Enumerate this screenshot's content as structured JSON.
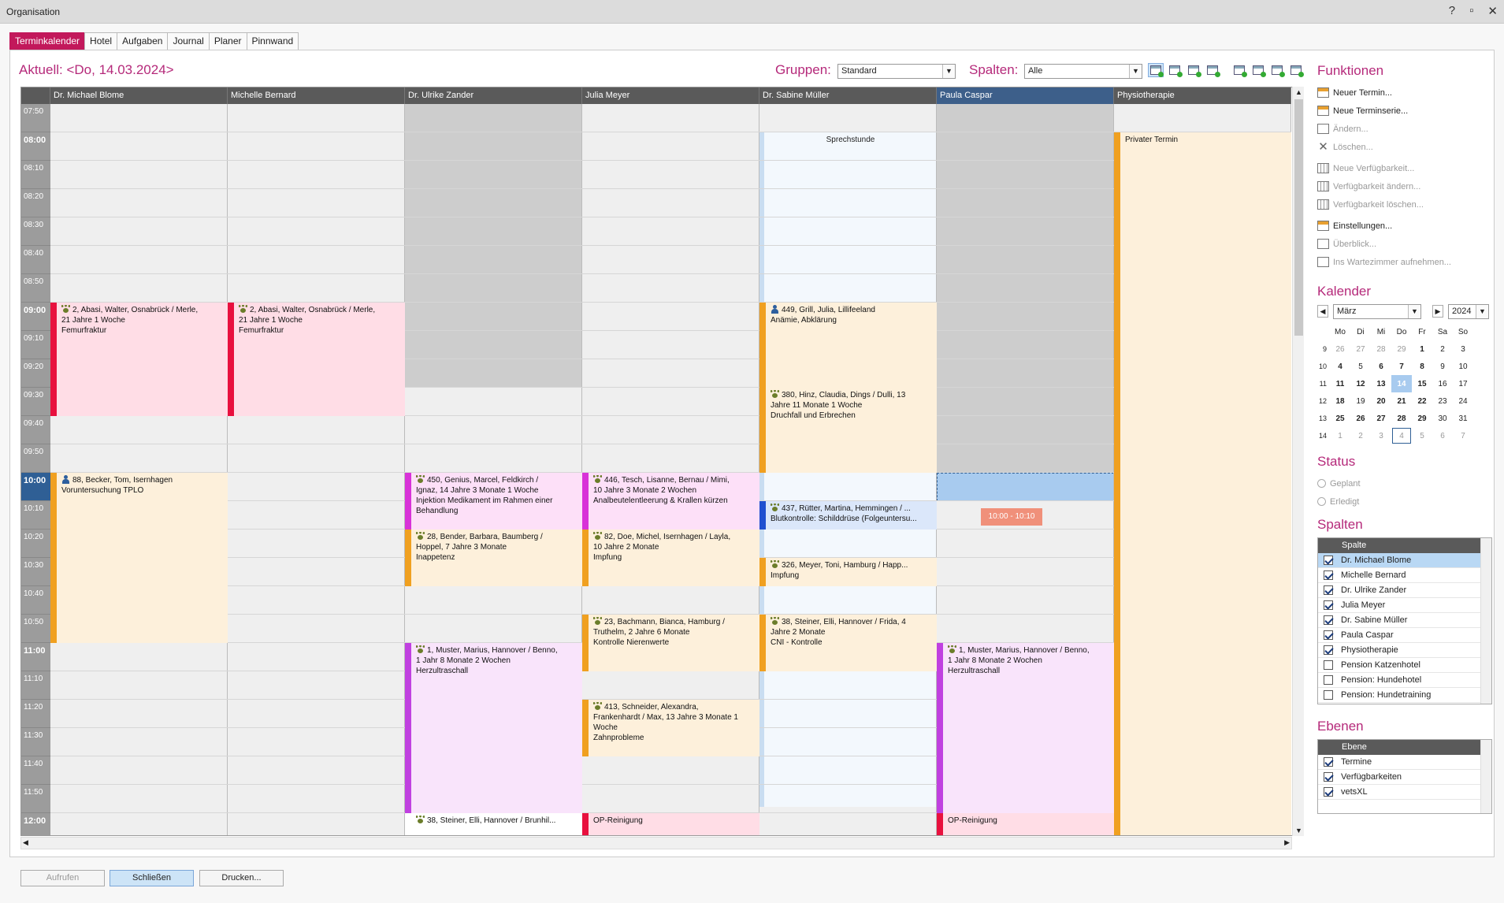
{
  "window": {
    "title": "Organisation",
    "help": "?",
    "minimize": "▫",
    "close": "✕"
  },
  "tabs": [
    "Terminkalender",
    "Hotel",
    "Aufgaben",
    "Journal",
    "Planer",
    "Pinnwand"
  ],
  "header": {
    "aktuell": "Aktuell: <Do, 14.03.2024>",
    "gruppen_label": "Gruppen:",
    "gruppen_value": "Standard",
    "spalten_label": "Spalten:",
    "spalten_value": "Alle"
  },
  "columns": [
    "Dr. Michael Blome",
    "Michelle Bernard",
    "Dr. Ulrike Zander",
    "Julia Meyer",
    "Dr. Sabine Müller",
    "Paula Caspar",
    "Physiotherapie"
  ],
  "times": [
    "07:50",
    "08:00",
    "08:10",
    "08:20",
    "08:30",
    "08:40",
    "08:50",
    "09:00",
    "09:10",
    "09:20",
    "09:30",
    "09:40",
    "09:50",
    "10:00",
    "10:10",
    "10:20",
    "10:30",
    "10:40",
    "10:50",
    "11:00",
    "11:10",
    "11:20",
    "11:30",
    "11:40",
    "11:50",
    "12:00"
  ],
  "appointments": {
    "a1": {
      "l1": "2, Abasi, Walter, Osnabrück / Merle,",
      "l2": "21 Jahre 1 Woche",
      "l3": "Femurfraktur"
    },
    "a2": {
      "l1": "2, Abasi, Walter, Osnabrück / Merle,",
      "l2": "21 Jahre 1 Woche",
      "l3": "Femurfraktur"
    },
    "a3": {
      "l1": "88, Becker, Tom, Isernhagen",
      "l2": "Voruntersuchung TPLO"
    },
    "a4": {
      "l1": "450, Genius, Marcel, Feldkirch /",
      "l2": "Ignaz, 14 Jahre 3 Monate 1 Woche",
      "l3": "Injektion Medikament im Rahmen einer",
      "l4": "Behandlung"
    },
    "a5": {
      "l1": "28, Bender, Barbara, Baumberg /",
      "l2": "Hoppel, 7 Jahre 3 Monate",
      "l3": "Inappetenz"
    },
    "a6": {
      "l1": "1, Muster, Marius, Hannover / Benno,",
      "l2": "1 Jahr 8 Monate 2 Wochen",
      "l3": "Herzultraschall"
    },
    "a7": {
      "l1": "38, Steiner, Elli, Hannover / Brunhil..."
    },
    "a8": {
      "l1": "446, Tesch, Lisanne, Bernau / Mimi,",
      "l2": "10 Jahre 3 Monate 2 Wochen",
      "l3": "Analbeutelentleerung & Krallen kürzen"
    },
    "a9": {
      "l1": "82, Doe, Michel, Isernhagen / Layla,",
      "l2": "10 Jahre 2 Monate",
      "l3": "Impfung"
    },
    "a10": {
      "l1": "23, Bachmann, Bianca, Hamburg /",
      "l2": "Truthelm, 2 Jahre 6 Monate",
      "l3": "Kontrolle Nierenwerte"
    },
    "a11": {
      "l1": "413, Schneider, Alexandra,",
      "l2": "Frankenhardt / Max, 13 Jahre 3 Monate 1",
      "l3": "Woche",
      "l4": "Zahnprobleme"
    },
    "a12": {
      "l1": "OP-Reinigung"
    },
    "a13": {
      "l1": "Sprechstunde"
    },
    "a14": {
      "l1": "449, Grill, Julia, Lillifeeland",
      "l2": "Anämie, Abklärung"
    },
    "a15": {
      "l1": "380, Hinz, Claudia, Dings / Dulli, 13",
      "l2": "Jahre 11 Monate 1 Woche",
      "l3": "Druchfall und Erbrechen"
    },
    "a16": {
      "l1": "437, Rütter, Martina, Hemmingen / ...",
      "l2": "Blutkontrolle: Schilddrüse (Folgeuntersu..."
    },
    "a17": {
      "l1": "326, Meyer, Toni, Hamburg / Happ...",
      "l2": "Impfung"
    },
    "a18": {
      "l1": "38, Steiner, Elli, Hannover / Frida, 4",
      "l2": "Jahre 2 Monate",
      "l3": "CNI - Kontrolle"
    },
    "a19": {
      "l1": "10:00 - 10:10"
    },
    "a20": {
      "l1": "1, Muster, Marius, Hannover / Benno,",
      "l2": "1 Jahr 8 Monate 2 Wochen",
      "l3": "Herzultraschall"
    },
    "a21": {
      "l1": "OP-Reinigung"
    },
    "a22": {
      "l1": "Privater Termin"
    }
  },
  "buttons": {
    "aufrufen": "Aufrufen",
    "schliessen": "Schließen",
    "drucken": "Drucken..."
  },
  "funktionen": {
    "title": "Funktionen",
    "items": [
      "Neuer Termin...",
      "Neue Terminserie...",
      "Ändern...",
      "Löschen...",
      "Neue Verfügbarkeit...",
      "Verfügbarkeit ändern...",
      "Verfügbarkeit löschen...",
      "Einstellungen...",
      "Überblick...",
      "Ins Wartezimmer aufnehmen..."
    ]
  },
  "kalender": {
    "title": "Kalender",
    "month": "März",
    "year": "2024",
    "weekdays": [
      "Mo",
      "Di",
      "Mi",
      "Do",
      "Fr",
      "Sa",
      "So"
    ],
    "weeks": [
      [
        "9",
        "26",
        "27",
        "28",
        "29",
        "1",
        "2",
        "3"
      ],
      [
        "10",
        "4",
        "5",
        "6",
        "7",
        "8",
        "9",
        "10"
      ],
      [
        "11",
        "11",
        "12",
        "13",
        "14",
        "15",
        "16",
        "17"
      ],
      [
        "12",
        "18",
        "19",
        "20",
        "21",
        "22",
        "23",
        "24"
      ],
      [
        "13",
        "25",
        "26",
        "27",
        "28",
        "29",
        "30",
        "31"
      ],
      [
        "14",
        "1",
        "2",
        "3",
        "4",
        "5",
        "6",
        "7"
      ]
    ]
  },
  "status": {
    "title": "Status",
    "items": [
      "Geplant",
      "Erledigt"
    ]
  },
  "spalten": {
    "title": "Spalten",
    "header": "Spalte",
    "items": [
      {
        "label": "Dr. Michael Blome",
        "checked": true
      },
      {
        "label": "Michelle Bernard",
        "checked": true
      },
      {
        "label": "Dr. Ulrike Zander",
        "checked": true
      },
      {
        "label": "Julia Meyer",
        "checked": true
      },
      {
        "label": "Dr. Sabine Müller",
        "checked": true
      },
      {
        "label": "Paula Caspar",
        "checked": true
      },
      {
        "label": "Physiotherapie",
        "checked": true
      },
      {
        "label": "Pension Katzenhotel",
        "checked": false
      },
      {
        "label": "Pension: Hundehotel",
        "checked": false
      },
      {
        "label": "Pension: Hundetraining",
        "checked": false
      }
    ]
  },
  "ebenen": {
    "title": "Ebenen",
    "header": "Ebene",
    "items": [
      {
        "label": "Termine",
        "checked": true
      },
      {
        "label": "Verfügbarkeiten",
        "checked": true
      },
      {
        "label": "vetsXL",
        "checked": true
      }
    ]
  },
  "colors": {
    "accent": "#b5297a",
    "tab_active": "#c2185b",
    "selected_col": "#3d5f8a",
    "now_marker": "#2f5f95"
  }
}
